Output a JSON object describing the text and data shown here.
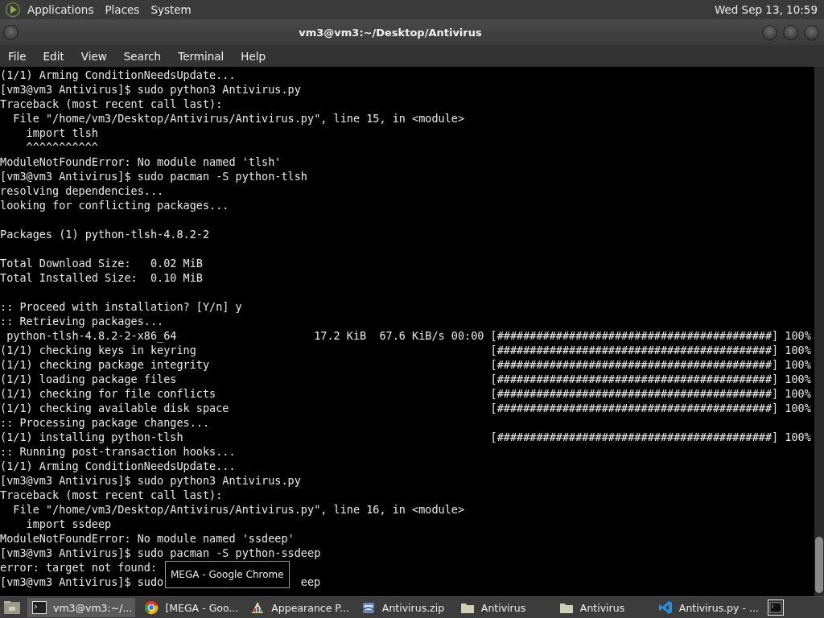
{
  "top_panel": {
    "menus": [
      "Applications",
      "Places",
      "System"
    ],
    "clock": "Wed Sep 13, 10:59"
  },
  "window": {
    "title": "vm3@vm3:~/Desktop/Antivirus"
  },
  "menu_bar": [
    "File",
    "Edit",
    "View",
    "Search",
    "Terminal",
    "Help"
  ],
  "terminal": {
    "lines": [
      {
        "kind": "plain",
        "text": "(1/1) Arming ConditionNeedsUpdate..."
      },
      {
        "kind": "plain",
        "text": "[vm3@vm3 Antivirus]$ sudo python3 Antivirus.py"
      },
      {
        "kind": "plain",
        "text": "Traceback (most recent call last):"
      },
      {
        "kind": "plain",
        "text": "  File \"/home/vm3/Desktop/Antivirus/Antivirus.py\", line 15, in <module>"
      },
      {
        "kind": "plain",
        "text": "    import tlsh"
      },
      {
        "kind": "plain",
        "text": "    ^^^^^^^^^^^"
      },
      {
        "kind": "plain",
        "text": "ModuleNotFoundError: No module named 'tlsh'"
      },
      {
        "kind": "plain",
        "text": "[vm3@vm3 Antivirus]$ sudo pacman -S python-tlsh"
      },
      {
        "kind": "plain",
        "text": "resolving dependencies..."
      },
      {
        "kind": "plain",
        "text": "looking for conflicting packages..."
      },
      {
        "kind": "blank"
      },
      {
        "kind": "plain",
        "text": "Packages (1) python-tlsh-4.8.2-2"
      },
      {
        "kind": "blank"
      },
      {
        "kind": "plain",
        "text": "Total Download Size:   0.02 MiB"
      },
      {
        "kind": "plain",
        "text": "Total Installed Size:  0.10 MiB"
      },
      {
        "kind": "blank"
      },
      {
        "kind": "plain",
        "text": ":: Proceed with installation? [Y/n] y"
      },
      {
        "kind": "plain",
        "text": ":: Retrieving packages..."
      },
      {
        "kind": "progress",
        "text": " python-tlsh-4.8.2-2-x86_64",
        "stats": "17.2 KiB  67.6 KiB/s 00:00",
        "bar": "[##########################################]",
        "percent": "100%"
      },
      {
        "kind": "progress",
        "text": "(1/1) checking keys in keyring",
        "bar": "[##########################################]",
        "percent": "100%"
      },
      {
        "kind": "progress",
        "text": "(1/1) checking package integrity",
        "bar": "[##########################################]",
        "percent": "100%"
      },
      {
        "kind": "progress",
        "text": "(1/1) loading package files",
        "bar": "[##########################################]",
        "percent": "100%"
      },
      {
        "kind": "progress",
        "text": "(1/1) checking for file conflicts",
        "bar": "[##########################################]",
        "percent": "100%"
      },
      {
        "kind": "progress",
        "text": "(1/1) checking available disk space",
        "bar": "[##########################################]",
        "percent": "100%"
      },
      {
        "kind": "plain",
        "text": ":: Processing package changes..."
      },
      {
        "kind": "progress",
        "text": "(1/1) installing python-tlsh",
        "bar": "[##########################################]",
        "percent": "100%"
      },
      {
        "kind": "plain",
        "text": ":: Running post-transaction hooks..."
      },
      {
        "kind": "plain",
        "text": "(1/1) Arming ConditionNeedsUpdate..."
      },
      {
        "kind": "plain",
        "text": "[vm3@vm3 Antivirus]$ sudo python3 Antivirus.py"
      },
      {
        "kind": "plain",
        "text": "Traceback (most recent call last):"
      },
      {
        "kind": "plain",
        "text": "  File \"/home/vm3/Desktop/Antivirus/Antivirus.py\", line 16, in <module>"
      },
      {
        "kind": "plain",
        "text": "    import ssdeep"
      },
      {
        "kind": "plain",
        "text": "ModuleNotFoundError: No module named 'ssdeep'"
      },
      {
        "kind": "plain",
        "text": "[vm3@vm3 Antivirus]$ sudo pacman -S python-ssdeep"
      },
      {
        "kind": "plain",
        "text": "error: target not found:"
      },
      {
        "kind": "covered",
        "text": "[vm3@vm3 Antivirus]$ sudo",
        "tail": "eep"
      }
    ]
  },
  "tooltip": "MEGA - Google Chrome",
  "taskbar": {
    "items": [
      {
        "kind": "terminal",
        "label": "vm3@vm3:~/...",
        "selected": true
      },
      {
        "kind": "browser",
        "label": "[MEGA - Goo...",
        "selected": false
      },
      {
        "kind": "paint",
        "label": "Appearance P...",
        "selected": false
      },
      {
        "kind": "archive",
        "label": "Antivirus.zip",
        "selected": false
      },
      {
        "kind": "folder",
        "label": "Antivirus",
        "selected": false
      },
      {
        "kind": "folder",
        "label": "Antivirus",
        "selected": false
      },
      {
        "kind": "editor",
        "label": "Antivirus.py - ...",
        "selected": false
      }
    ]
  }
}
